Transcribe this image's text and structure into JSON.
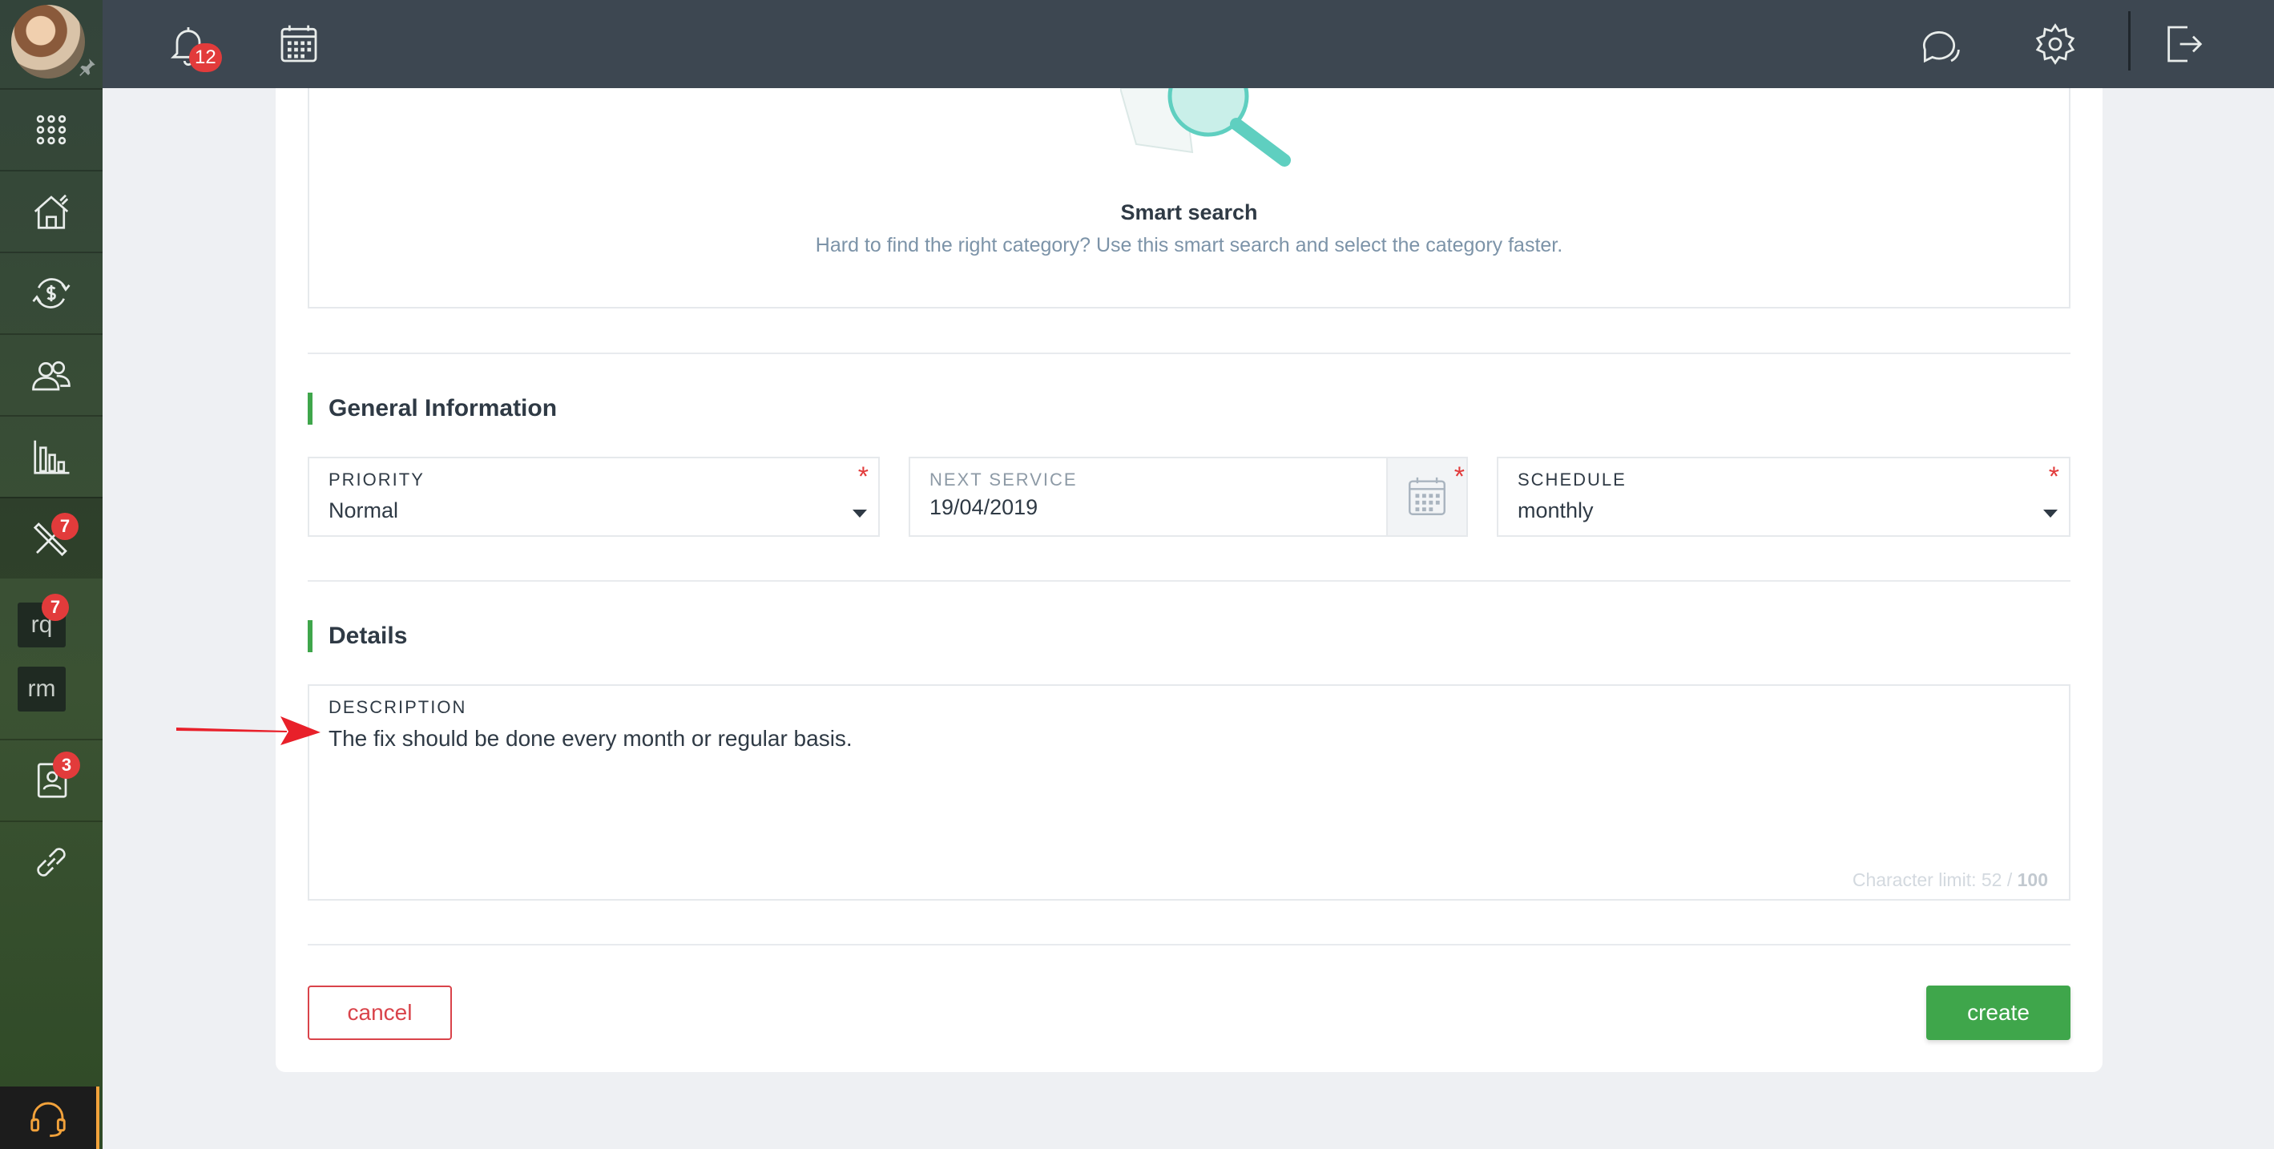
{
  "topbar": {
    "notifications_count": "12"
  },
  "sidebar": {
    "badges": {
      "maintenance": "7",
      "rq": "7",
      "contacts": "3"
    },
    "shortcuts": [
      "rq",
      "rm"
    ]
  },
  "smart_search": {
    "title": "Smart search",
    "subtitle": "Hard to find the right category? Use this smart search and select the category faster."
  },
  "general": {
    "title": "General Information",
    "priority": {
      "label": "PRIORITY",
      "value": "Normal"
    },
    "next_service": {
      "label": "NEXT SERVICE",
      "value": "19/04/2019"
    },
    "schedule": {
      "label": "SCHEDULE",
      "value": "monthly"
    },
    "required_mark": "*"
  },
  "details": {
    "title": "Details",
    "description": {
      "label": "DESCRIPTION",
      "value": "The fix should be done every month or regular basis.",
      "limit_text": "Character limit: 52 / ",
      "limit_max": "100"
    }
  },
  "actions": {
    "cancel": "cancel",
    "create": "create"
  },
  "colors": {
    "accent_green": "#3fa64b",
    "danger_red": "#d9434a",
    "topbar": "#3d4751"
  }
}
